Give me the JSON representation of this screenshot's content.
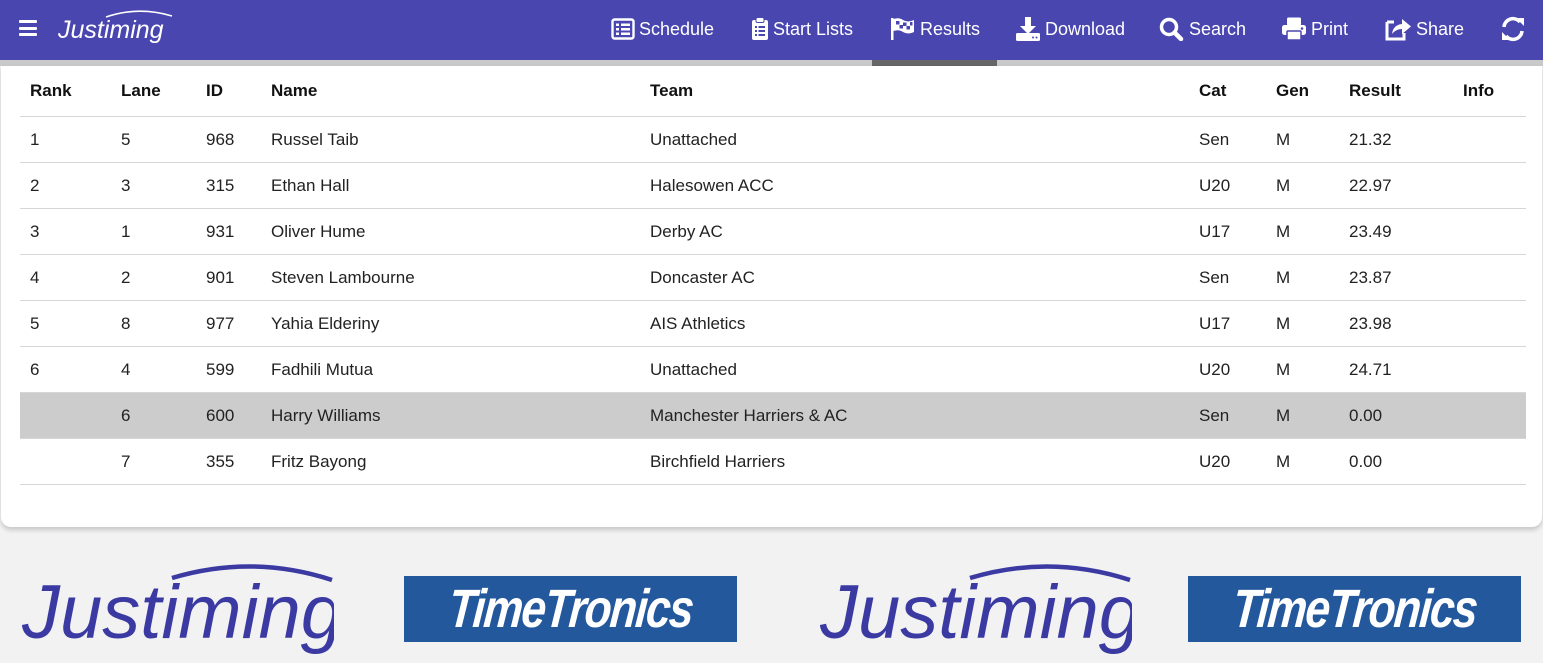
{
  "brand": {
    "name": "Justiming",
    "colors": {
      "navbar": "#4a46b0",
      "active_tab": "#666666",
      "highlight_row": "#cccccc",
      "timetronics_blue": "#24589c"
    }
  },
  "nav": {
    "menu_icon": "hamburger-icon",
    "items": [
      {
        "label": "Schedule",
        "icon": "list-icon"
      },
      {
        "label": "Start Lists",
        "icon": "clipboard-icon"
      },
      {
        "label": "Results",
        "icon": "checkered-flag-icon",
        "active": true
      },
      {
        "label": "Download",
        "icon": "download-icon"
      },
      {
        "label": "Search",
        "icon": "search-icon"
      },
      {
        "label": "Print",
        "icon": "print-icon"
      },
      {
        "label": "Share",
        "icon": "share-icon"
      }
    ],
    "refresh_icon": "refresh-icon"
  },
  "table": {
    "headers": [
      "Rank",
      "Lane",
      "ID",
      "Name",
      "Team",
      "Cat",
      "Gen",
      "Result",
      "Info"
    ],
    "rows": [
      {
        "rank": "1",
        "lane": "5",
        "id": "968",
        "name": "Russel Taib",
        "team": "Unattached",
        "cat": "Sen",
        "gen": "M",
        "result": "21.32",
        "info": ""
      },
      {
        "rank": "2",
        "lane": "3",
        "id": "315",
        "name": "Ethan Hall",
        "team": "Halesowen ACC",
        "cat": "U20",
        "gen": "M",
        "result": "22.97",
        "info": ""
      },
      {
        "rank": "3",
        "lane": "1",
        "id": "931",
        "name": "Oliver Hume",
        "team": "Derby AC",
        "cat": "U17",
        "gen": "M",
        "result": "23.49",
        "info": ""
      },
      {
        "rank": "4",
        "lane": "2",
        "id": "901",
        "name": "Steven Lambourne",
        "team": "Doncaster AC",
        "cat": "Sen",
        "gen": "M",
        "result": "23.87",
        "info": ""
      },
      {
        "rank": "5",
        "lane": "8",
        "id": "977",
        "name": "Yahia Elderiny",
        "team": "AIS Athletics",
        "cat": "U17",
        "gen": "M",
        "result": "23.98",
        "info": ""
      },
      {
        "rank": "6",
        "lane": "4",
        "id": "599",
        "name": "Fadhili Mutua",
        "team": "Unattached",
        "cat": "U20",
        "gen": "M",
        "result": "24.71",
        "info": ""
      },
      {
        "rank": "",
        "lane": "6",
        "id": "600",
        "name": "Harry Williams",
        "team": "Manchester Harriers & AC",
        "cat": "Sen",
        "gen": "M",
        "result": "0.00",
        "info": "",
        "highlighted": true
      },
      {
        "rank": "",
        "lane": "7",
        "id": "355",
        "name": "Fritz Bayong",
        "team": "Birchfield Harriers",
        "cat": "U20",
        "gen": "M",
        "result": "0.00",
        "info": ""
      }
    ]
  },
  "footer": {
    "logos": [
      {
        "name": "Justiming"
      },
      {
        "name": "TimeTronics"
      },
      {
        "name": "Justiming"
      },
      {
        "name": "TimeTronics"
      }
    ]
  }
}
